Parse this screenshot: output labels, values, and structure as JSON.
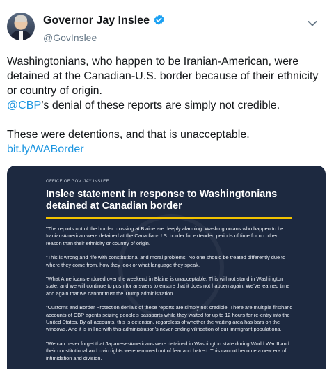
{
  "tweet": {
    "author_name": "Governor Jay Inslee",
    "author_handle": "@GovInslee",
    "body_line1": "Washingtonians, who happen to be Iranian-American, were detained at the Canadian-U.S. border because of their ethnicity or country of origin.",
    "mention": "@CBP",
    "body_line2_rest": "’s denial of these reports are simply not credible.",
    "body_line3": "These were detentions, and that is unacceptable.",
    "link_text": "bit.ly/WABorder"
  },
  "statement": {
    "office": "OFFICE OF GOV. JAY INSLEE",
    "title": "Inslee statement in response to Washingtonians detained at Canadian border",
    "paragraphs": [
      "\"The reports out of the border crossing at Blaine are deeply alarming. Washingtonians who happen to be Iranian-American were detained at the Canadian-U.S. border for extended periods of time for no other reason than their ethnicity or country of origin.",
      "\"This is wrong and rife with constitutional and moral problems. No one should be treated differently due to where they come from, how they look or what language they speak.",
      "\"What Americans endured over the weekend in Blaine is unacceptable. This will not stand in Washington state, and we will continue to push for answers to ensure that it does not happen again. We’ve learned time and again that we cannot trust the Trump administration.",
      "\"Customs and Border Protection denials of these reports are simply not credible. There are multiple firsthand accounts of CBP agents seizing people’s passports while they waited for up to 12 hours for re-entry into the United States. By all accounts, this is detention, regardless of whether the waiting area has bars on the windows. And it is in line with this administration’s never-ending vilification of our immigrant populations.",
      "\"We can never forget that Japanese-Americans were detained in Washington state during World War II and their constitutional and civic rights were removed out of fear and hatred. This cannot become a new era of intimidation and division."
    ]
  },
  "colors": {
    "link": "#1b95e0",
    "card_background": "#1d2940",
    "title_rule": "#f2c200",
    "verified_badge": "#1da1f2"
  },
  "icons": [
    "verified-badge-icon",
    "chevron-down-icon"
  ]
}
